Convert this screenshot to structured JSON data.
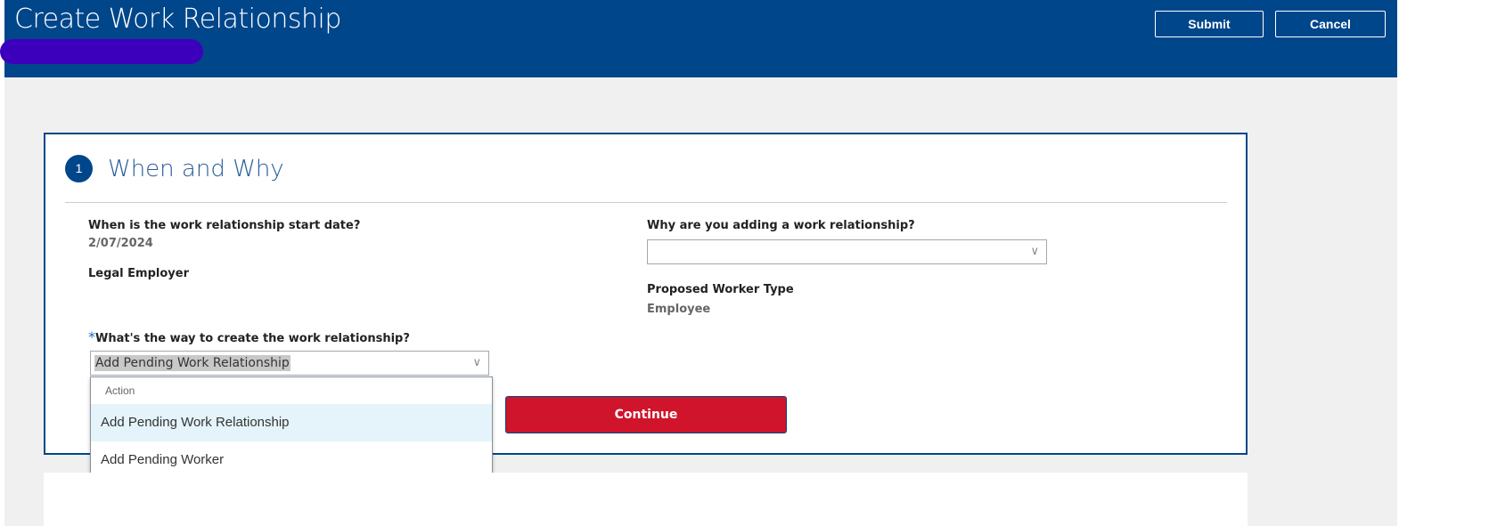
{
  "header": {
    "title": "Create Work Relationship",
    "submit_label": "Submit",
    "cancel_label": "Cancel"
  },
  "section": {
    "step": "1",
    "title": "When and Why"
  },
  "fields": {
    "start_date_label": "When is the work relationship start date?",
    "start_date_value": "2/07/2024",
    "legal_employer_label": "Legal Employer",
    "reason_label": "Why are you adding a work relationship?",
    "reason_value": "",
    "worker_type_label": "Proposed Worker Type",
    "worker_type_value": "Employee",
    "way_required": "*",
    "way_label": "What's the way to create the work relationship?",
    "way_value": "Add Pending Work Relationship"
  },
  "dropdown": {
    "header": "Action",
    "options": [
      "Add Pending Work Relationship",
      "Add Pending Worker"
    ]
  },
  "continue_label": "Continue",
  "colors": {
    "brand": "#00468b",
    "continue": "#cf142b",
    "highlight": "#e4f4fa"
  }
}
